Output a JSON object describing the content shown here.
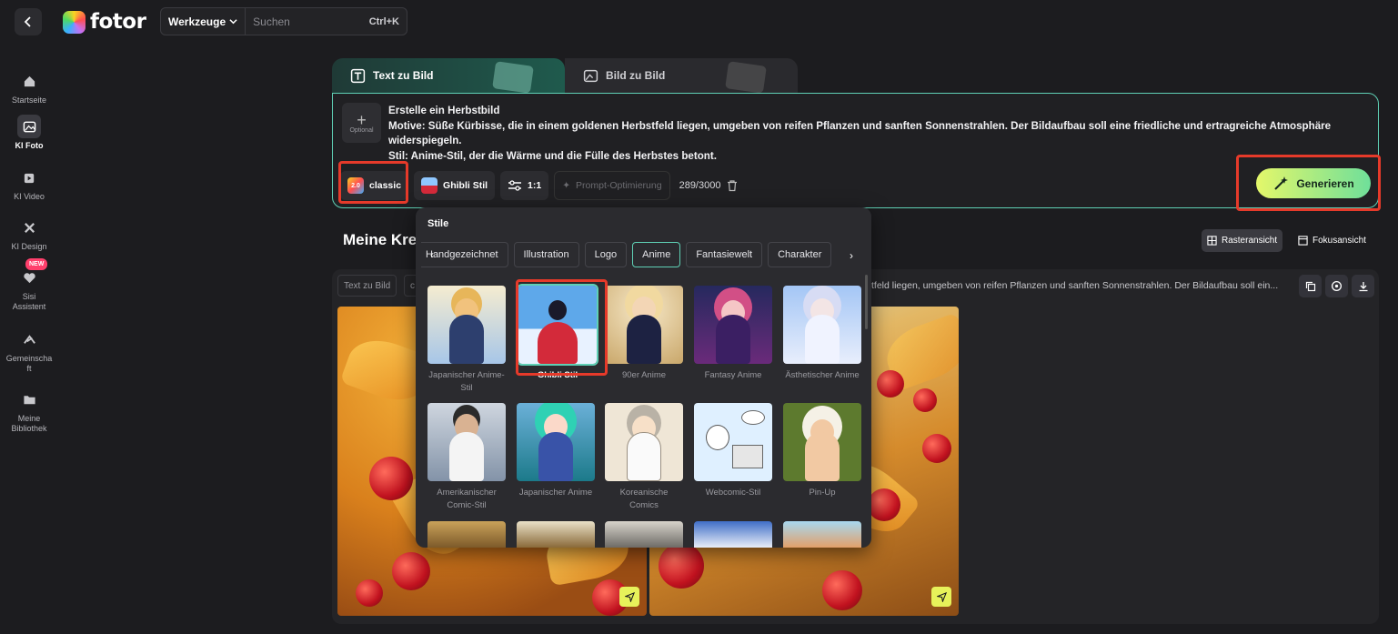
{
  "topbar": {
    "logo_text": "fotor",
    "tools_label": "Werkzeuge",
    "search_placeholder": "Suchen",
    "shortcut": "Ctrl+K"
  },
  "sidebar": {
    "items": [
      {
        "label": "Startseite",
        "icon": "home-icon"
      },
      {
        "label": "KI Foto",
        "icon": "image-icon",
        "active": true
      },
      {
        "label": "KI Video",
        "icon": "video-icon"
      },
      {
        "label": "KI Design",
        "icon": "design-icon"
      },
      {
        "label": "Sisi Assistent",
        "icon": "heart-icon",
        "badge": "NEW"
      },
      {
        "label": "Gemeinschaft",
        "icon": "community-icon"
      },
      {
        "label": "Meine Bibliothek",
        "icon": "folder-icon"
      }
    ]
  },
  "tabs": [
    {
      "label": "Text zu Bild",
      "active": true
    },
    {
      "label": "Bild zu Bild",
      "active": false
    }
  ],
  "prompt": {
    "optional_label": "Optional",
    "lines": [
      "Erstelle ein Herbstbild",
      "Motive: Süße Kürbisse, die in einem goldenen Herbstfeld liegen, umgeben von reifen Pflanzen und sanften Sonnenstrahlen. Der Bildaufbau soll eine friedliche und ertragreiche Atmosphäre widerspiegeln.",
      "Stil: Anime-Stil, der die Wärme und die Fülle des Herbstes betont."
    ],
    "model_label": "classic",
    "model_badge": "2.0",
    "style_label": "Ghibli Stil",
    "ratio_label": "1:1",
    "optimize_label": "Prompt-Optimierung",
    "counter": "289/3000",
    "generate_label": "Generieren"
  },
  "main": {
    "title": "Meine Kre",
    "grid_view_label": "Rasteransicht",
    "focus_view_label": "Fokusansicht",
    "result_chip_1": "Text zu Bild",
    "result_chip_2": "c",
    "result_text": "tfeld liegen, umgeben von reifen Pflanzen und sanften Sonnenstrahlen. Der Bildaufbau soll ein..."
  },
  "styles_dropdown": {
    "title": "Stile",
    "categories": [
      "Handgezeichnet",
      "Illustration",
      "Logo",
      "Anime",
      "Fantasiewelt",
      "Charakter"
    ],
    "selected_category": "Anime",
    "cards": [
      {
        "label": "Japanischer Anime-Stil"
      },
      {
        "label": "Ghibli Stil",
        "selected": true
      },
      {
        "label": "90er Anime"
      },
      {
        "label": "Fantasy Anime"
      },
      {
        "label": "Ästhetischer Anime"
      },
      {
        "label": "Amerikanischer Comic-Stil"
      },
      {
        "label": "Japanischer Anime"
      },
      {
        "label": "Koreanische Comics"
      },
      {
        "label": "Webcomic-Stil"
      },
      {
        "label": "Pin-Up"
      }
    ]
  },
  "colors": {
    "accent": "#5fd0b5",
    "highlight": "#e63a2a",
    "generate_start": "#e4f76a",
    "generate_end": "#6fdf9a"
  }
}
